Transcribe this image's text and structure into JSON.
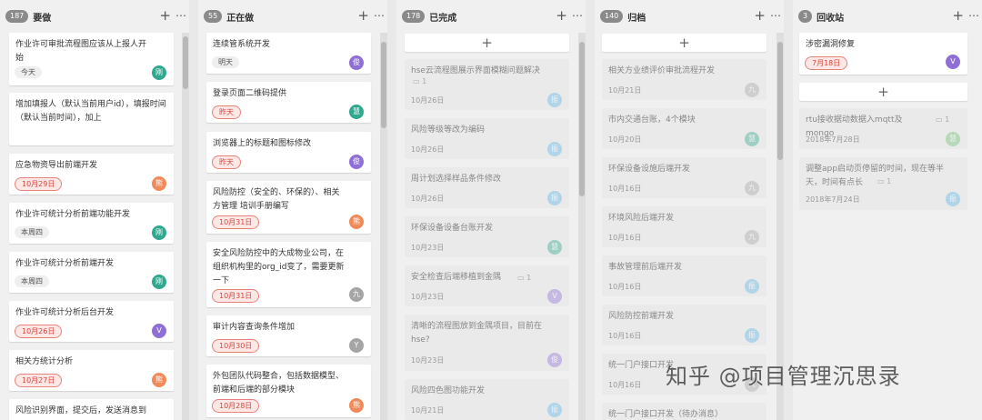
{
  "colors": {
    "red": "#d9443d",
    "teal": "#2fa88e",
    "purple": "#8f6fd6",
    "orange": "#ef8a5a",
    "gray": "#a5a5a5",
    "green": "#6cbf71",
    "blue": "#5bb5e6"
  },
  "columns": [
    {
      "count": "187",
      "title": "要做",
      "cards": [
        {
          "text": "作业许可审批流程图应该从上报人开始",
          "date": "今天",
          "date_style": "plain",
          "avatar": "刚"
        },
        {
          "text": "增加填报人（默认当前用户id），填报时间（默认当前时间），加上",
          "date": "",
          "date_style": "",
          "avatar": ""
        },
        {
          "text": "应急物资导出前端开发",
          "date": "10月29日",
          "date_style": "red",
          "avatar": "熊"
        },
        {
          "text": "作业许可统计分析前端功能开发",
          "date": "本周四",
          "date_style": "plain",
          "avatar": "刚"
        },
        {
          "text": "作业许可统计分析前端开发",
          "date": "本周四",
          "date_style": "plain",
          "avatar": "刚"
        },
        {
          "text": "作业许可统计分析后台开发",
          "date": "10月26日",
          "date_style": "red",
          "avatar": "V"
        },
        {
          "text": "相关方统计分析",
          "date": "10月27日",
          "date_style": "red",
          "avatar": "熊"
        },
        {
          "text": "风险识别界面，提交后，发送消息到",
          "date": "",
          "date_style": "",
          "avatar": ""
        }
      ]
    },
    {
      "count": "55",
      "title": "正在做",
      "cards": [
        {
          "text": "连续管系统开发",
          "date": "明天",
          "date_style": "plain",
          "avatar": "俊"
        },
        {
          "text": "登录页面二维码提供",
          "date": "昨天",
          "date_style": "red",
          "avatar": "慧"
        },
        {
          "text": "浏览器上的标题和图标修改",
          "date": "昨天",
          "date_style": "red",
          "avatar": "俊"
        },
        {
          "text": "风险防控（安全的、环保的）、相关方管理 培训手册编写",
          "date": "10月31日",
          "date_style": "red",
          "avatar": "熊"
        },
        {
          "text": "安全风险防控中的大成物业公司，在组织机构里的org_id变了，需要更新一下",
          "date": "10月31日",
          "date_style": "red",
          "avatar": "九"
        },
        {
          "text": "审计内容查询条件增加",
          "date": "10月30日",
          "date_style": "red",
          "avatar": "Y"
        },
        {
          "text": "外包团队代码整合，包括数据模型、前端和后端的部分模块",
          "date": "10月28日",
          "date_style": "red",
          "avatar": "熊"
        }
      ]
    },
    {
      "count": "178",
      "title": "已完成",
      "cards": [
        {
          "text": "hse云流程图展示界面模糊问题解决",
          "date": "10月26日",
          "comments": "1",
          "avatar": "振"
        },
        {
          "text": "风险等级等改为编码",
          "date": "10月26日",
          "comments": "",
          "avatar": "振"
        },
        {
          "text": "周计划选择样品条件修改",
          "date": "10月26日",
          "comments": "",
          "avatar": "振"
        },
        {
          "text": "环保设备设备台账开发",
          "date": "10月23日",
          "comments": "",
          "avatar": "慧"
        },
        {
          "text": "安全检查后端移植到金隅",
          "date": "10月23日",
          "comments": "1",
          "avatar": "V"
        },
        {
          "text": "清晰的流程图放到金隅项目，目前在hse?",
          "date": "10月23日",
          "comments": "",
          "avatar": "俊"
        },
        {
          "text": "风险四色图功能开发",
          "date": "10月21日",
          "comments": "",
          "avatar": "振"
        }
      ]
    },
    {
      "count": "140",
      "title": "归档",
      "cards": [
        {
          "text": "相关方业绩评价审批流程开发",
          "date": "10月21日",
          "avatar": "九"
        },
        {
          "text": "市内交通台账，4个模块",
          "date": "10月20日",
          "avatar": "慧"
        },
        {
          "text": "环保设备设施后端开发",
          "date": "10月16日",
          "avatar": "九"
        },
        {
          "text": "环境风险后端开发",
          "date": "10月16日",
          "avatar": "九"
        },
        {
          "text": "事故管理前后端开发",
          "date": "10月16日",
          "avatar": "振"
        },
        {
          "text": "风险防控前端开发",
          "date": "10月16日",
          "avatar": "振"
        },
        {
          "text": "统一门户接口开发",
          "date": "10月16日",
          "avatar": "九"
        },
        {
          "text": "统一门户接口开发（待办消息）",
          "date": "",
          "avatar": ""
        }
      ]
    },
    {
      "count": "3",
      "title": "回收站",
      "cards": [
        {
          "text": "涉密漏洞修复",
          "date": "7月18日",
          "date_style": "red",
          "comments": "",
          "avatar": "V"
        },
        {
          "text": "rtu接收据动数据入mqtt及mongo",
          "date": "2018年7月28日",
          "date_style": "flat",
          "comments": "1",
          "avatar": "慧"
        },
        {
          "text": "调整app启动页停留的时间，现在等半天，时间有点长",
          "date": "2018年7月24日",
          "date_style": "flat",
          "comments": "1",
          "avatar": "振"
        }
      ]
    }
  ],
  "watermark": "知乎 @项目管理沉思录"
}
